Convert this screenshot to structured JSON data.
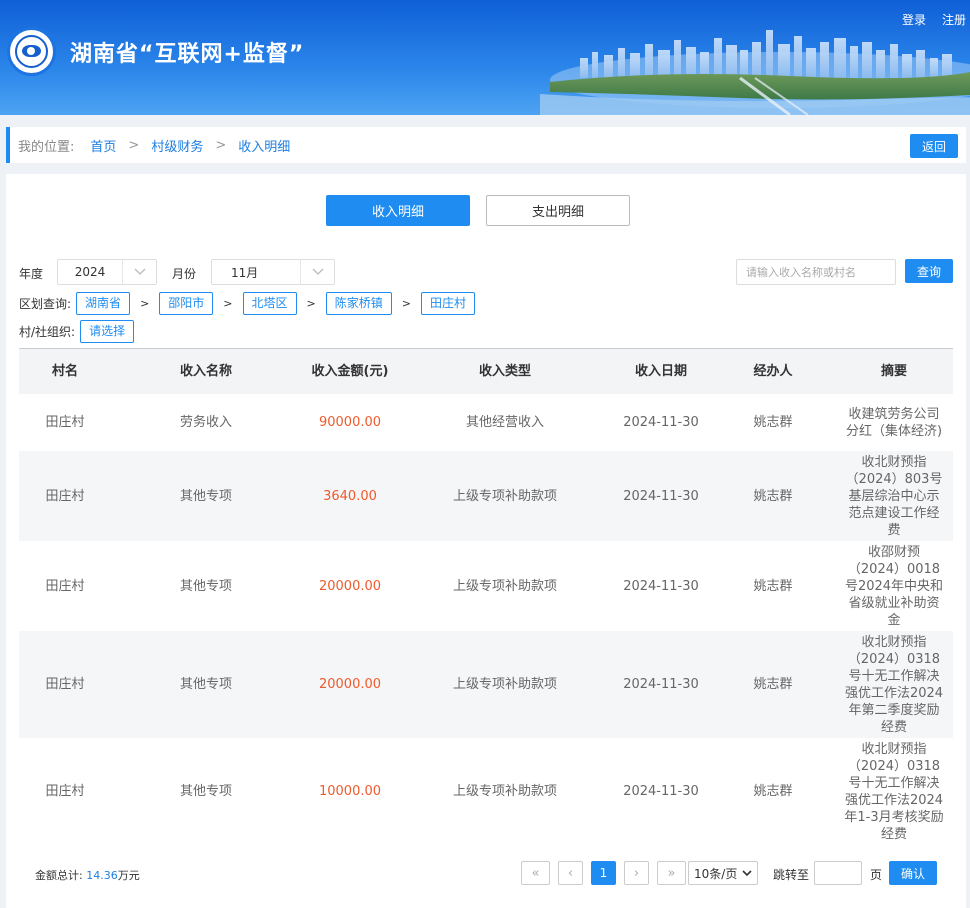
{
  "header": {
    "site_title": "湖南省“互联网+监督”",
    "login": "登录",
    "register": "注册"
  },
  "breadcrumb": {
    "label": "我的位置:",
    "items": [
      "首页",
      "村级财务",
      "收入明细"
    ],
    "separator": ">",
    "back": "返回"
  },
  "tabs": {
    "income": "收入明细",
    "expense": "支出明细"
  },
  "filters": {
    "year_label": "年度",
    "year_value": "2024",
    "month_label": "月份",
    "month_value": "11月",
    "search_placeholder": "请输入收入名称或村名",
    "query": "查询",
    "region_label": "区划查询:",
    "regions": [
      "湖南省",
      "邵阳市",
      "北塔区",
      "陈家桥镇",
      "田庄村"
    ],
    "org_label": "村/社组织:",
    "org_value": "请选择"
  },
  "table": {
    "headers": [
      "村名",
      "收入名称",
      "收入金额(元)",
      "收入类型",
      "收入日期",
      "经办人",
      "摘要"
    ],
    "rows": [
      {
        "village": "田庄村",
        "name": "劳务收入",
        "amount": "90000.00",
        "type": "其他经营收入",
        "date": "2024-11-30",
        "handler": "姚志群",
        "summary": "收建筑劳务公司分红（集体经济)"
      },
      {
        "village": "田庄村",
        "name": "其他专项",
        "amount": "3640.00",
        "type": "上级专项补助款项",
        "date": "2024-11-30",
        "handler": "姚志群",
        "summary": "收北财预指（2024）803号基层综治中心示范点建设工作经费"
      },
      {
        "village": "田庄村",
        "name": "其他专项",
        "amount": "20000.00",
        "type": "上级专项补助款项",
        "date": "2024-11-30",
        "handler": "姚志群",
        "summary": "收邵财预（2024）0018号2024年中央和省级就业补助资金"
      },
      {
        "village": "田庄村",
        "name": "其他专项",
        "amount": "20000.00",
        "type": "上级专项补助款项",
        "date": "2024-11-30",
        "handler": "姚志群",
        "summary": "收北财预指（2024）0318号十无工作解决强优工作法2024年第二季度奖励经费"
      },
      {
        "village": "田庄村",
        "name": "其他专项",
        "amount": "10000.00",
        "type": "上级专项补助款项",
        "date": "2024-11-30",
        "handler": "姚志群",
        "summary": "收北财预指（2024）0318号十无工作解决强优工作法2024年1-3月考核奖励经费"
      }
    ]
  },
  "footer": {
    "total_label": "金额总计:",
    "total_value": "14.36",
    "total_unit": "万元",
    "first": "«",
    "prev": "‹",
    "current_page": "1",
    "next": "›",
    "last": "»",
    "page_size": "10条/页",
    "jump_label": "跳转至",
    "page_label": "页",
    "confirm": "确认"
  },
  "colors": {
    "header_blue": "#1565d8",
    "accent": "#1e8cf0",
    "amount": "#ee5a2c"
  }
}
